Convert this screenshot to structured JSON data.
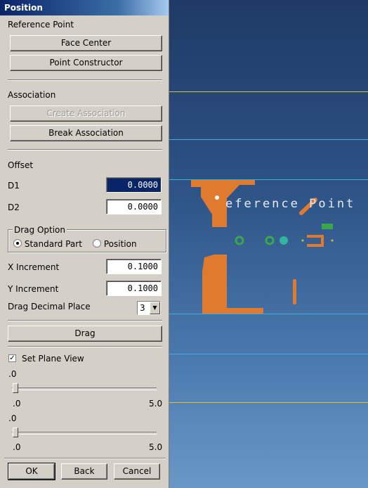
{
  "panel": {
    "title": "Position",
    "reference_point_label": "Reference Point",
    "face_center_button": "Face Center",
    "point_constructor_button": "Point Constructor",
    "association_label": "Association",
    "create_association_button": "Create Association",
    "break_association_button": "Break Association",
    "offset_label": "Offset",
    "d1_label": "D1",
    "d1_value": "0.0000",
    "d2_label": "D2",
    "d2_value": "0.0000",
    "drag_option_label": "Drag Option",
    "standard_part_option": "Standard Part",
    "position_option": "Position",
    "x_increment_label": "X Increment",
    "x_increment_value": "0.1000",
    "y_increment_label": "Y Increment",
    "y_increment_value": "0.1000",
    "drag_decimal_label": "Drag Decimal Place",
    "drag_decimal_value": "3",
    "drag_button": "Drag",
    "set_plane_view_label": "Set Plane View",
    "slider1": {
      "value": ".0",
      "min": ".0",
      "max": "5.0"
    },
    "slider2": {
      "value": ".0",
      "min": ".0",
      "max": "5.0"
    },
    "ok_button": "OK",
    "back_button": "Back",
    "cancel_button": "Cancel"
  },
  "viewport": {
    "reference_text": "eference Point",
    "colors": {
      "shape": "#e07a2e",
      "green": "#3aa84a",
      "teal": "#2fb5a0",
      "yellow_line": "#d8c23a",
      "cyan_line": "#3fb0d8"
    }
  }
}
